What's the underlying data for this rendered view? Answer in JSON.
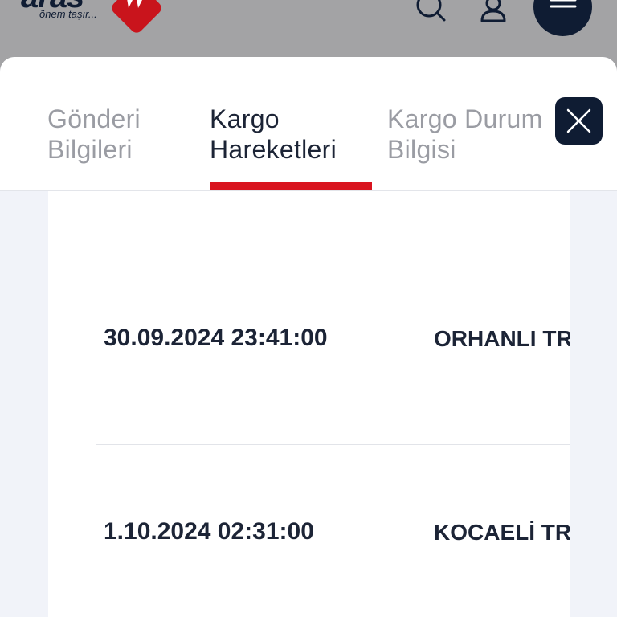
{
  "header": {
    "logo_text": "aras",
    "logo_tagline": "önem taşır...",
    "icons": [
      "search-icon",
      "user-icon",
      "menu-icon"
    ]
  },
  "tabs": [
    {
      "label": "Gönderi\nBilgileri",
      "active": false
    },
    {
      "label": "Kargo\nHareketleri",
      "active": true
    },
    {
      "label": "Kargo Durum\nBilgisi",
      "active": false
    }
  ],
  "close_icon": "close-icon",
  "movements": [
    {
      "datetime": "30.09.2024 23:41:00",
      "location": "ORHANLI TR"
    },
    {
      "datetime": "1.10.2024 02:31:00",
      "location": "KOCAELİ TR"
    }
  ],
  "colors": {
    "navy": "#0f1c33",
    "accent_red": "#d9141f",
    "inactive_tab": "#9a9ca3"
  }
}
